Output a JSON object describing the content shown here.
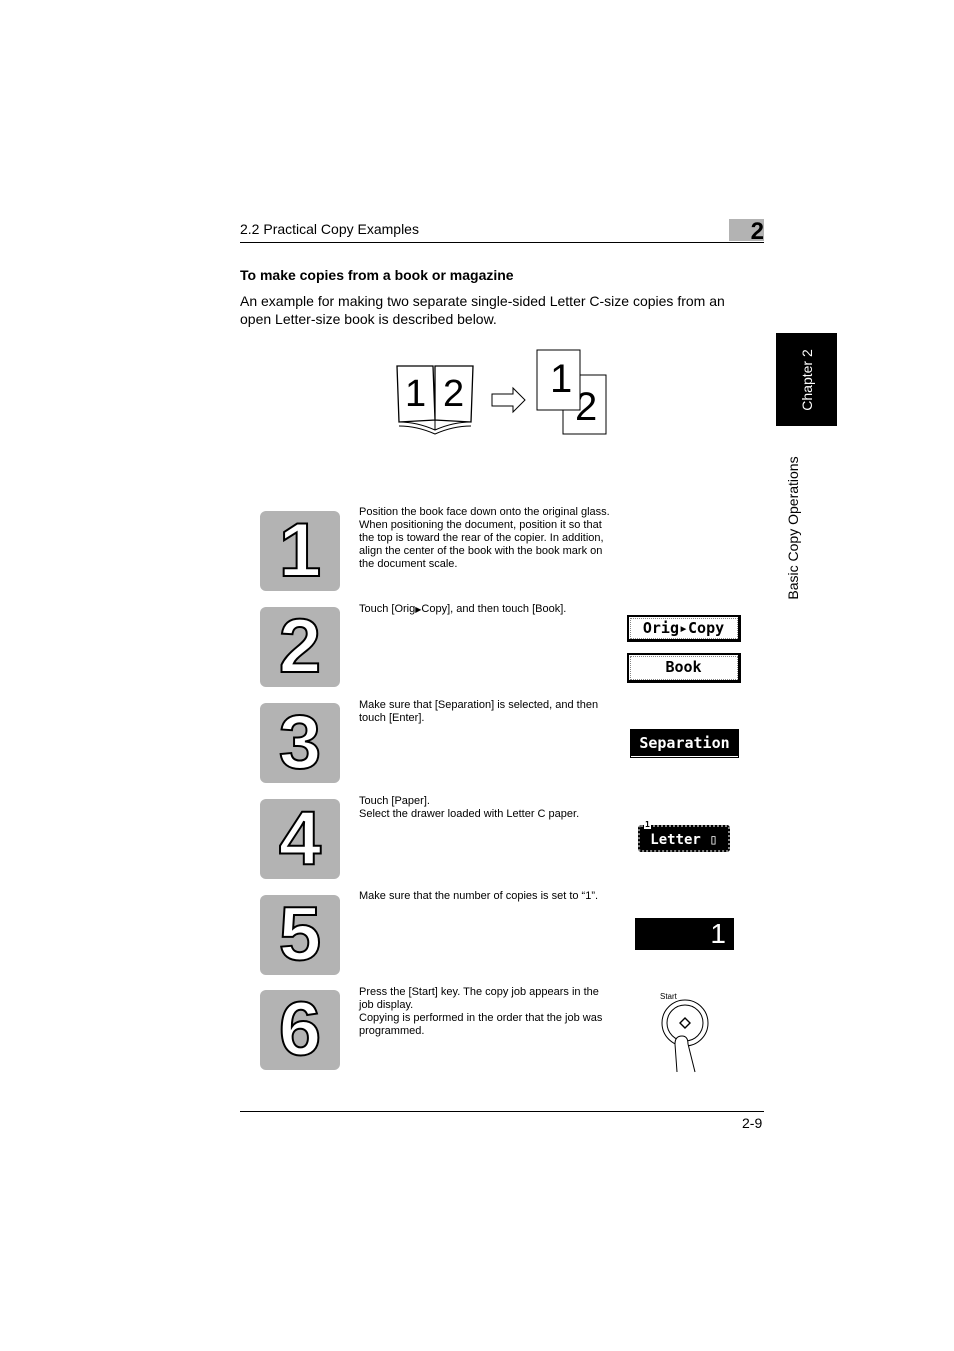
{
  "header": {
    "section": "2.2 Practical Copy Examples",
    "chapter_number": "2"
  },
  "title": "To make copies from a book or magazine",
  "intro": "An example for making two separate single-sided Letter C-size copies from an open Letter-size book is described below.",
  "side_tab": {
    "chapter": "Chapter 2",
    "section": "Basic Copy Operations"
  },
  "figure": {
    "book_pages": [
      "1",
      "2"
    ],
    "copies": [
      "1",
      "2"
    ]
  },
  "steps": [
    {
      "number": "1",
      "text": "Position the book face down onto the original glass. When positioning the document, position it so that the top is toward the rear of the copier. In addition, align the center of the book with the book mark on the document scale."
    },
    {
      "number": "2",
      "text_before": "Touch [Orig",
      "text_after": "Copy], and then touch [Book].",
      "buttons": [
        "Orig▸Copy",
        "Book"
      ]
    },
    {
      "number": "3",
      "text": "Make sure that [Separation] is selected, and then touch [Enter].",
      "button": "Separation"
    },
    {
      "number": "4",
      "text": "Touch [Paper].\nSelect the drawer loaded with Letter C paper.",
      "button": "Letter",
      "drawer": "1"
    },
    {
      "number": "5",
      "text": "Make sure that the number of copies is set to “1”.",
      "display": "1"
    },
    {
      "number": "6",
      "text": "Press the [Start] key. The copy job appears in the job display.\nCopying is performed in the order that the job was programmed.",
      "key_label": "Start"
    }
  ],
  "footer": {
    "page": "2-9"
  }
}
